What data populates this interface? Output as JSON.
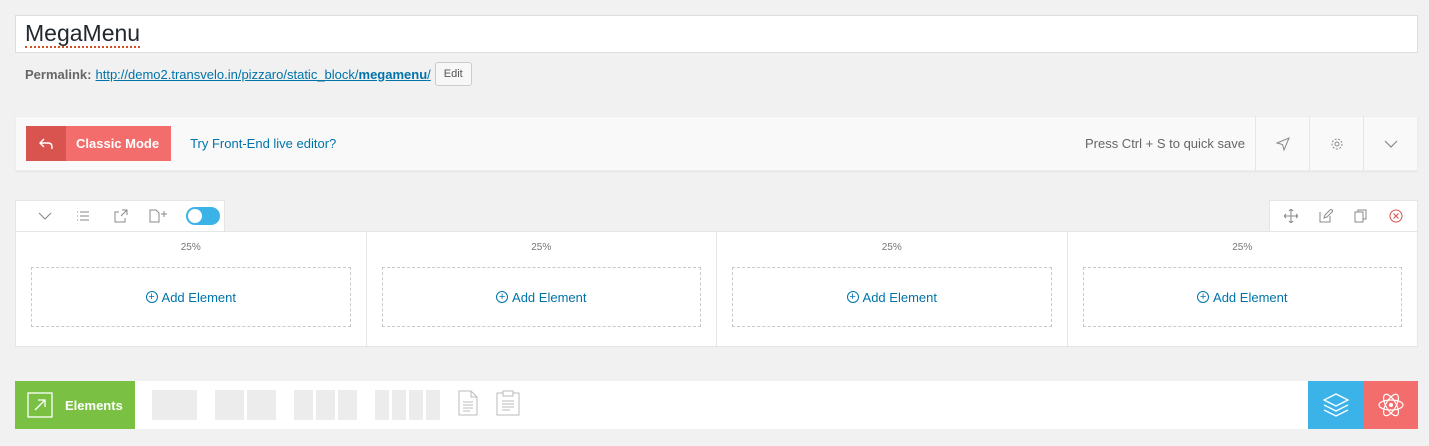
{
  "post": {
    "title": "MegaMenu",
    "permalink_label": "Permalink:",
    "permalink_prefix": "http://demo2.transvelo.in/pizzaro/static_block/",
    "permalink_slug": "megamenu",
    "permalink_suffix": "/",
    "edit_label": "Edit"
  },
  "toolbar": {
    "classic_mode_label": "Classic Mode",
    "frontend_link": "Try Front-End live editor?",
    "quick_save_hint": "Press Ctrl + S to quick save"
  },
  "row": {
    "toggle_on": true,
    "columns": [
      {
        "width": "25%",
        "add_label": "Add Element"
      },
      {
        "width": "25%",
        "add_label": "Add Element"
      },
      {
        "width": "25%",
        "add_label": "Add Element"
      },
      {
        "width": "25%",
        "add_label": "Add Element"
      }
    ]
  },
  "bottom_bar": {
    "elements_label": "Elements"
  },
  "colors": {
    "classic_red": "#f26d6b",
    "elements_green": "#7ac143",
    "layers_blue": "#3bb3e8",
    "link_blue": "#0073aa"
  }
}
